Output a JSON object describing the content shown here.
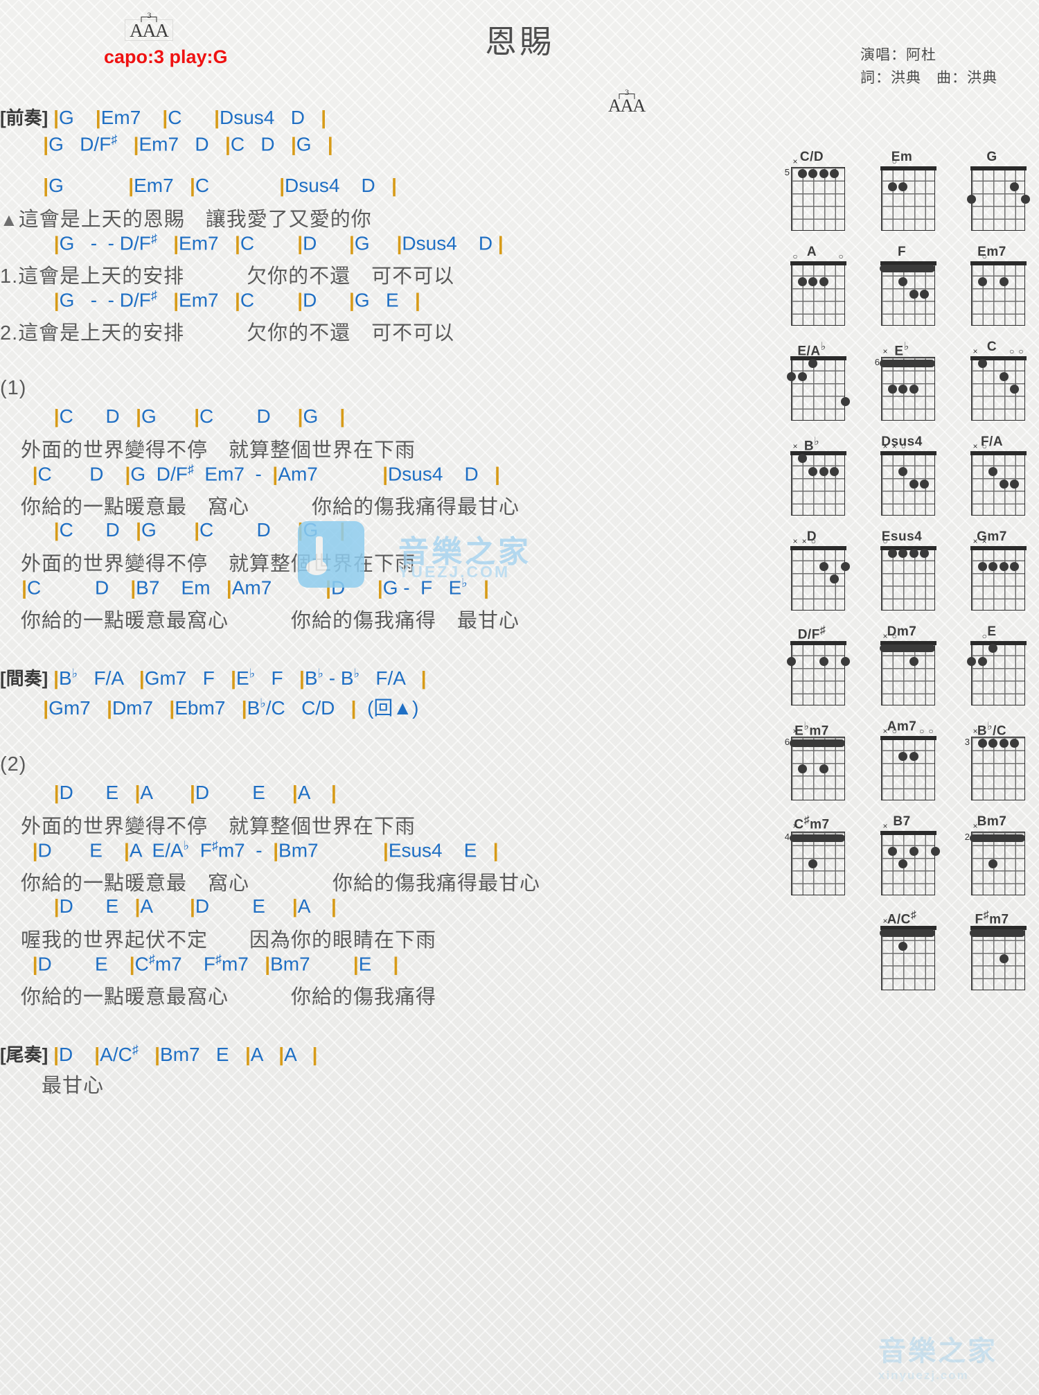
{
  "header": {
    "title": "恩賜",
    "aaa_marker": "AAA",
    "triplet": "3",
    "capo": "capo:3 play:G",
    "singer": "演唱：阿杜",
    "writer": "詞：洪典　曲：洪典"
  },
  "sections": [
    {
      "type": "chord",
      "label": "[前奏]",
      "text": "[前奏] |G    |Em7    |C      |Dsus4   D   |"
    },
    {
      "type": "chord",
      "label": "",
      "text": "        |G   D/F#   |Em7   D   |C   D   |G   |"
    },
    {
      "type": "spacer"
    },
    {
      "type": "chord",
      "label": "",
      "text": "        |G            |Em7   |C             |Dsus4    D   |"
    },
    {
      "type": "lyric",
      "text": "▲這會是上天的恩賜　讓我愛了又愛的你"
    },
    {
      "type": "chord",
      "label": "",
      "text": "          |G   -  - D/F#   |Em7   |C        |D      |G     |Dsus4    D |"
    },
    {
      "type": "lyric",
      "text": "1.這會是上天的安排　　　欠你的不還　可不可以"
    },
    {
      "type": "chord",
      "label": "",
      "text": "          |G   -  - D/F#   |Em7   |C        |D      |G   E   |"
    },
    {
      "type": "lyric",
      "text": "2.這會是上天的安排　　　欠你的不還　可不可以"
    },
    {
      "type": "spacer-lg"
    },
    {
      "type": "lyric",
      "text": "(1)"
    },
    {
      "type": "chord",
      "label": "",
      "text": "          |C      D   |G       |C        D     |G    |"
    },
    {
      "type": "lyric",
      "text": "　外面的世界變得不停　就算整個世界在下雨"
    },
    {
      "type": "chord",
      "label": "",
      "text": "      |C       D    |G  D/F#  Em7  -  |Am7            |Dsus4    D   |"
    },
    {
      "type": "lyric",
      "text": "　你給的一點暖意最　窩心　　　你給的傷我痛得最甘心"
    },
    {
      "type": "chord",
      "label": "",
      "text": "          |C      D   |G       |C        D     |G    |"
    },
    {
      "type": "lyric",
      "text": "　外面的世界變得不停　就算整個世界在下雨"
    },
    {
      "type": "chord",
      "label": "",
      "text": "    |C          D    |B7    Em   |Am7          |D      |G -  F   Eb   |"
    },
    {
      "type": "lyric",
      "text": "　你給的一點暖意最窩心　　　你給的傷我痛得　最甘心"
    },
    {
      "type": "spacer-lg"
    },
    {
      "type": "chord",
      "label": "[間奏]",
      "text": "[間奏] |Bb   F/A   |Gm7   F   |Eb   F   |Bb - Bb   F/A   |"
    },
    {
      "type": "chord",
      "label": "",
      "text": "        |Gm7   |Dm7   |Ebm7   |Bb/C   C/D   |  (回▲)"
    },
    {
      "type": "spacer-lg"
    },
    {
      "type": "lyric",
      "text": "(2)"
    },
    {
      "type": "chord",
      "label": "",
      "text": "          |D      E   |A       |D        E     |A    |"
    },
    {
      "type": "lyric",
      "text": "　外面的世界變得不停　就算整個世界在下雨"
    },
    {
      "type": "chord",
      "label": "",
      "text": "      |D       E    |A  E/Ab  F#m7  -  |Bm7            |Esus4    E   |"
    },
    {
      "type": "lyric",
      "text": "　你給的一點暖意最　窩心　　　　你給的傷我痛得最甘心"
    },
    {
      "type": "chord",
      "label": "",
      "text": "          |D      E   |A       |D        E     |A    |"
    },
    {
      "type": "lyric",
      "text": "　喔我的世界起伏不定　　因為你的眼睛在下雨"
    },
    {
      "type": "chord",
      "label": "",
      "text": "      |D        E    |C#m7    F#m7   |Bm7        |E    |"
    },
    {
      "type": "lyric",
      "text": "　你給的一點暖意最窩心　　　你給的傷我痛得"
    },
    {
      "type": "spacer-lg"
    },
    {
      "type": "chord",
      "label": "[尾奏]",
      "text": "[尾奏] |D    |A/C#   |Bm7   E   |A   |A   |"
    },
    {
      "type": "lyric",
      "text": "　　最甘心"
    }
  ],
  "chord_diagrams": [
    {
      "name": "C/D",
      "fret": "5",
      "markers": [
        "x",
        "",
        "",
        "",
        "",
        ""
      ],
      "dots": [
        [
          1,
          2
        ],
        [
          1,
          3
        ],
        [
          1,
          4
        ],
        [
          1,
          5
        ]
      ]
    },
    {
      "name": "Em",
      "fret": "",
      "markers": [
        "",
        "o",
        "",
        "",
        "",
        ""
      ],
      "dots": [
        [
          2,
          2
        ],
        [
          2,
          3
        ]
      ]
    },
    {
      "name": "G",
      "fret": "",
      "markers": [
        "",
        "",
        "",
        "",
        "",
        ""
      ],
      "dots": [
        [
          2,
          5
        ],
        [
          3,
          1
        ],
        [
          3,
          6
        ]
      ]
    },
    {
      "name": "A",
      "fret": "",
      "markers": [
        "o",
        "",
        "",
        "",
        "",
        "o"
      ],
      "dots": [
        [
          2,
          2
        ],
        [
          2,
          3
        ],
        [
          2,
          4
        ]
      ]
    },
    {
      "name": "F",
      "fret": "",
      "markers": [
        "",
        "",
        "",
        "",
        "",
        ""
      ],
      "barre": 1,
      "dots": [
        [
          2,
          3
        ],
        [
          3,
          4
        ],
        [
          3,
          5
        ]
      ]
    },
    {
      "name": "Em7",
      "fret": "",
      "markers": [
        "",
        "o",
        "",
        "",
        "",
        ""
      ],
      "dots": [
        [
          2,
          2
        ],
        [
          2,
          4
        ]
      ]
    },
    {
      "name": "E/Ab",
      "fret": "",
      "markers": [
        "",
        "",
        "",
        "",
        "",
        ""
      ],
      "dots": [
        [
          1,
          3
        ],
        [
          2,
          1
        ],
        [
          2,
          2
        ],
        [
          4,
          6
        ]
      ]
    },
    {
      "name": "Eb",
      "fret": "6",
      "markers": [
        "x",
        "",
        "",
        "",
        "",
        ""
      ],
      "barre": 1,
      "dots": [
        [
          3,
          2
        ],
        [
          3,
          3
        ],
        [
          3,
          4
        ]
      ]
    },
    {
      "name": "C",
      "fret": "",
      "markers": [
        "x",
        "",
        "",
        "",
        "o",
        "o"
      ],
      "dots": [
        [
          1,
          2
        ],
        [
          2,
          4
        ],
        [
          3,
          5
        ]
      ]
    },
    {
      "name": "Bb",
      "fret": "",
      "markers": [
        "x",
        "",
        "",
        "",
        "",
        ""
      ],
      "dots": [
        [
          1,
          2
        ],
        [
          2,
          3
        ],
        [
          2,
          4
        ],
        [
          2,
          5
        ]
      ]
    },
    {
      "name": "Dsus4",
      "fret": "",
      "markers": [
        "x",
        "x",
        "o",
        "",
        "",
        ""
      ],
      "dots": [
        [
          2,
          3
        ],
        [
          3,
          4
        ],
        [
          3,
          5
        ]
      ]
    },
    {
      "name": "F/A",
      "fret": "",
      "markers": [
        "x",
        "o",
        "",
        "",
        "",
        ""
      ],
      "dots": [
        [
          2,
          3
        ],
        [
          3,
          4
        ],
        [
          3,
          5
        ]
      ]
    },
    {
      "name": "D",
      "fret": "",
      "markers": [
        "x",
        "x",
        "o",
        "",
        "",
        ""
      ],
      "dots": [
        [
          2,
          4
        ],
        [
          2,
          6
        ],
        [
          3,
          5
        ]
      ]
    },
    {
      "name": "Esus4",
      "fret": "",
      "markers": [
        "o",
        "",
        "",
        "",
        "",
        ""
      ],
      "dots": [
        [
          1,
          2
        ],
        [
          1,
          3
        ],
        [
          1,
          4
        ],
        [
          1,
          5
        ]
      ]
    },
    {
      "name": "Gm7",
      "fret": "",
      "markers": [
        "x",
        "x",
        "",
        "",
        "",
        ""
      ],
      "dots": [
        [
          2,
          2
        ],
        [
          2,
          3
        ],
        [
          2,
          4
        ],
        [
          2,
          5
        ]
      ]
    },
    {
      "name": "D/F#",
      "fret": "",
      "markers": [
        "",
        "",
        "",
        "",
        "",
        ""
      ],
      "dots": [
        [
          2,
          1
        ],
        [
          2,
          4
        ],
        [
          2,
          6
        ]
      ]
    },
    {
      "name": "Dm7",
      "fret": "",
      "markers": [
        "x",
        "o",
        "",
        "",
        "",
        ""
      ],
      "barre": 1,
      "dots": [
        [
          2,
          4
        ]
      ]
    },
    {
      "name": "E",
      "fret": "",
      "markers": [
        "",
        "o",
        "",
        "",
        "",
        ""
      ],
      "dots": [
        [
          1,
          3
        ],
        [
          2,
          1
        ],
        [
          2,
          2
        ]
      ]
    },
    {
      "name": "Ebm7",
      "fret": "6",
      "markers": [
        "x",
        "",
        "",
        "",
        "",
        ""
      ],
      "barre": 1,
      "dots": [
        [
          3,
          2
        ],
        [
          3,
          4
        ]
      ]
    },
    {
      "name": "Am7",
      "fret": "",
      "markers": [
        "x",
        "o",
        "",
        "",
        "o",
        "o"
      ],
      "dots": [
        [
          2,
          3
        ],
        [
          2,
          4
        ]
      ]
    },
    {
      "name": "Bb/C",
      "fret": "3",
      "markers": [
        "x",
        "",
        "",
        "",
        "",
        ""
      ],
      "dots": [
        [
          1,
          2
        ],
        [
          1,
          3
        ],
        [
          1,
          4
        ],
        [
          1,
          5
        ]
      ]
    },
    {
      "name": "C#m7",
      "fret": "4",
      "markers": [
        "x",
        "",
        "",
        "",
        "",
        ""
      ],
      "barre": 1,
      "dots": [
        [
          3,
          3
        ]
      ]
    },
    {
      "name": "B7",
      "fret": "",
      "markers": [
        "x",
        "",
        "",
        "",
        "",
        ""
      ],
      "dots": [
        [
          2,
          2
        ],
        [
          2,
          4
        ],
        [
          2,
          6
        ],
        [
          3,
          3
        ]
      ]
    },
    {
      "name": "Bm7",
      "fret": "2",
      "markers": [
        "x",
        "",
        "",
        "",
        "",
        ""
      ],
      "barre": 1,
      "dots": [
        [
          3,
          3
        ]
      ]
    },
    {
      "name": "A/C#",
      "fret": "",
      "markers": [
        "x",
        "",
        "",
        "",
        "",
        ""
      ],
      "barre": 1,
      "dots": [
        [
          2,
          3
        ]
      ]
    },
    {
      "name": "F#m7",
      "fret": "",
      "markers": [
        "",
        "",
        "",
        "",
        "",
        ""
      ],
      "barre": 1,
      "dots": [
        [
          3,
          4
        ]
      ]
    }
  ],
  "watermark": {
    "brand": "音樂之家",
    "url": "YUEZJ.COM",
    "corner": "音樂之家",
    "corner_sub": "xinyuezj.com"
  }
}
